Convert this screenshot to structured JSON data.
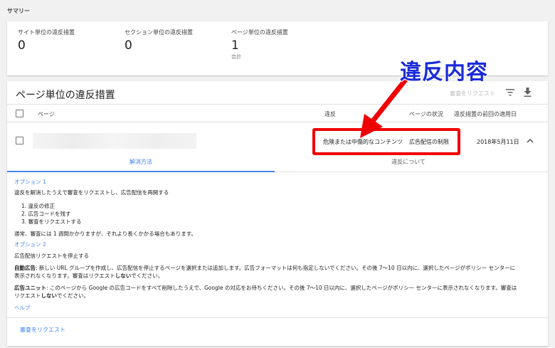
{
  "summary": {
    "title": "サマリー",
    "metrics": [
      {
        "label": "サイト単位の違反措置",
        "value": "0",
        "sub": ""
      },
      {
        "label": "セクション単位の違反措置",
        "value": "0",
        "sub": ""
      },
      {
        "label": "ページ単位の違反措置",
        "value": "1",
        "sub": "合計"
      }
    ]
  },
  "table": {
    "title": "ページ単位の違反措置",
    "request_label": "審査をリクエスト",
    "columns": {
      "page": "ページ",
      "violation": "違反",
      "status": "ページの状況",
      "last_applied": "違反措置の前回の適用日"
    },
    "rows": [
      {
        "violation": "危険または中傷的なコンテンツ",
        "status": "広告配信の制限",
        "date": "2018年5月11日"
      }
    ]
  },
  "tabs": {
    "active": "解消方法",
    "inactive": "違反について"
  },
  "content": {
    "option1_title": "オプション 1",
    "option1_desc": "違反を解消したうえで審査をリクエストし、広告配信を再開する",
    "steps": [
      "1. 違反の修正",
      "2. 広告コードを残す",
      "3. 審査をリクエストする"
    ],
    "note": "通常、審査には 1 週間かかりますが、それより長くかかる場合もあります。",
    "option2_title": "オプション 2",
    "option2_desc": "広告配信リクエストを停止する",
    "auto_ads_label": "自動広告",
    "auto_ads_text1": ": 新しい URL グループを作成し、広告配信を停止するページを選択または追加します。広告フォーマットは何も指定しないでください。その後 7〜10 日以内に、選択したページがポリシー センターに",
    "auto_ads_text2_pre": "表示されなくなります。審査はリクエスト",
    "auto_ads_text2_bold": "しない",
    "auto_ads_text2_post": "でください。",
    "ad_unit_label": "広告ユニット",
    "ad_unit_text1": ": このページから Google の広告コードをすべて削除したうえで、Google の対応をお待ちください。その後 7〜10 日以内に、選択したページがポリシー センターに表示されなくなります。審査は",
    "ad_unit_text2_pre": "リクエスト",
    "ad_unit_text2_bold": "しない",
    "ad_unit_text2_post": "でください。",
    "help_link": "ヘルプ"
  },
  "footer": {
    "request_link": "審査をリクエスト"
  },
  "annotation": {
    "label": "違反内容",
    "color": "#1a2bd8",
    "box_color": "#f00000"
  }
}
